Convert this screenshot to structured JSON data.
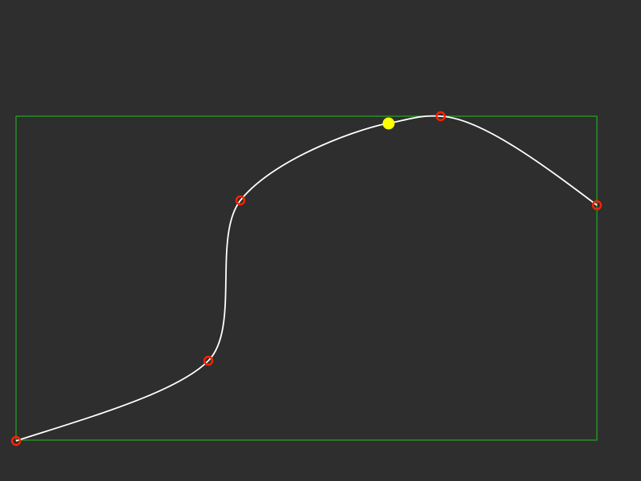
{
  "colors": {
    "background": "#2e2e2e",
    "bounding_box": "#22aa22",
    "curve": "#ffffff",
    "control_point": "#ff2200",
    "cursor_point": "#ffff00"
  },
  "curve": {
    "type": "smooth spline through control points",
    "control_point_count": 6,
    "highlighted_point_count": 1
  }
}
